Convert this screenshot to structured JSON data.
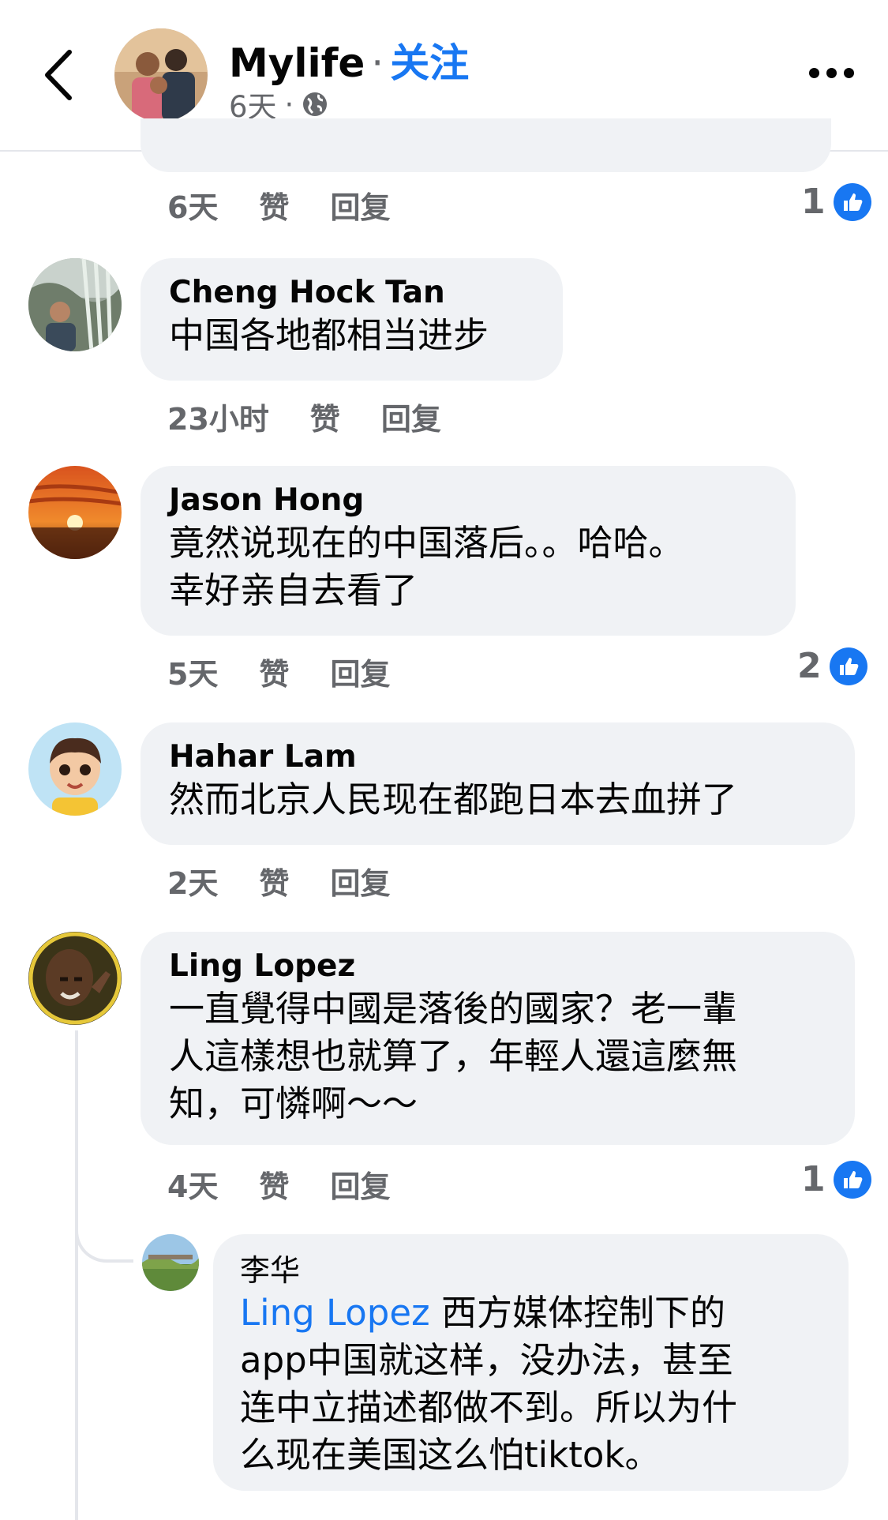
{
  "header": {
    "page_name": "Mylife",
    "separator": "·",
    "follow_label": "关注",
    "post_age": "6天",
    "meta_separator": "·",
    "back_icon": "chevron-left-icon",
    "privacy_icon": "globe-icon",
    "more_icon": "more-horizontal-icon"
  },
  "top_actions": {
    "time": "6天",
    "like_label": "赞",
    "reply_label": "回复",
    "like_count": "1"
  },
  "comments": [
    {
      "author": "Cheng Hock Tan",
      "text": "中国各地都相当进步",
      "time": "23小时",
      "like_label": "赞",
      "reply_label": "回复",
      "like_count": ""
    },
    {
      "author": "Jason Hong",
      "text_line1": "竟然说现在的中国落后。。哈哈。",
      "text_line2": "幸好亲自去看了",
      "time": "5天",
      "like_label": "赞",
      "reply_label": "回复",
      "like_count": "2"
    },
    {
      "author": "Hahar Lam",
      "text": "然而北京人民现在都跑日本去血拼了",
      "time": "2天",
      "like_label": "赞",
      "reply_label": "回复",
      "like_count": ""
    },
    {
      "author": "Ling Lopez",
      "text_line1": "一直覺得中國是落後的國家？老一輩",
      "text_line2": "人這樣想也就算了，年輕人還這麼無",
      "text_line3": "知，可憐啊～～",
      "time": "4天",
      "like_label": "赞",
      "reply_label": "回复",
      "like_count": "1"
    }
  ],
  "reply": {
    "author": "李华",
    "mention": "Ling Lopez",
    "text_line1": " 西方媒体控制下的",
    "text_line2": "app中国就这样，没办法，甚至",
    "text_line3": "连中立描述都做不到。所以为什",
    "text_line4": "么现在美国这么怕tiktok。"
  },
  "colors": {
    "accent": "#1877f2",
    "bubble": "#f0f2f5",
    "muted_text": "#65676b"
  }
}
